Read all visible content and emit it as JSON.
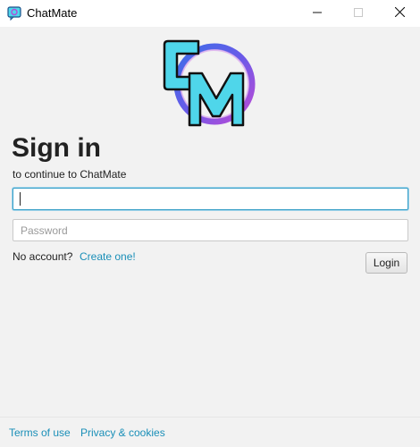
{
  "window": {
    "title": "ChatMate",
    "icon": "chatmate-app-icon",
    "controls": {
      "minimize_icon": "minimize-icon",
      "maximize_icon": "maximize-icon",
      "close_icon": "close-icon"
    }
  },
  "logo": {
    "name": "chatmate-logo",
    "letters": "CM",
    "colors": {
      "cyan": "#4fd6ea",
      "purple": "#b34dd9",
      "blue": "#3a6ee8",
      "outline": "#111111"
    }
  },
  "signin": {
    "heading": "Sign in",
    "subheading": "to continue to ChatMate",
    "username_value": "",
    "password_placeholder": "Password",
    "no_account_text": "No account?",
    "create_link": "Create one!",
    "login_button": "Login"
  },
  "footer": {
    "terms": "Terms of use",
    "privacy": "Privacy & cookies"
  },
  "colors": {
    "link": "#1a8fb8",
    "focus_border": "#3aa0c8",
    "background": "#f2f2f2"
  }
}
